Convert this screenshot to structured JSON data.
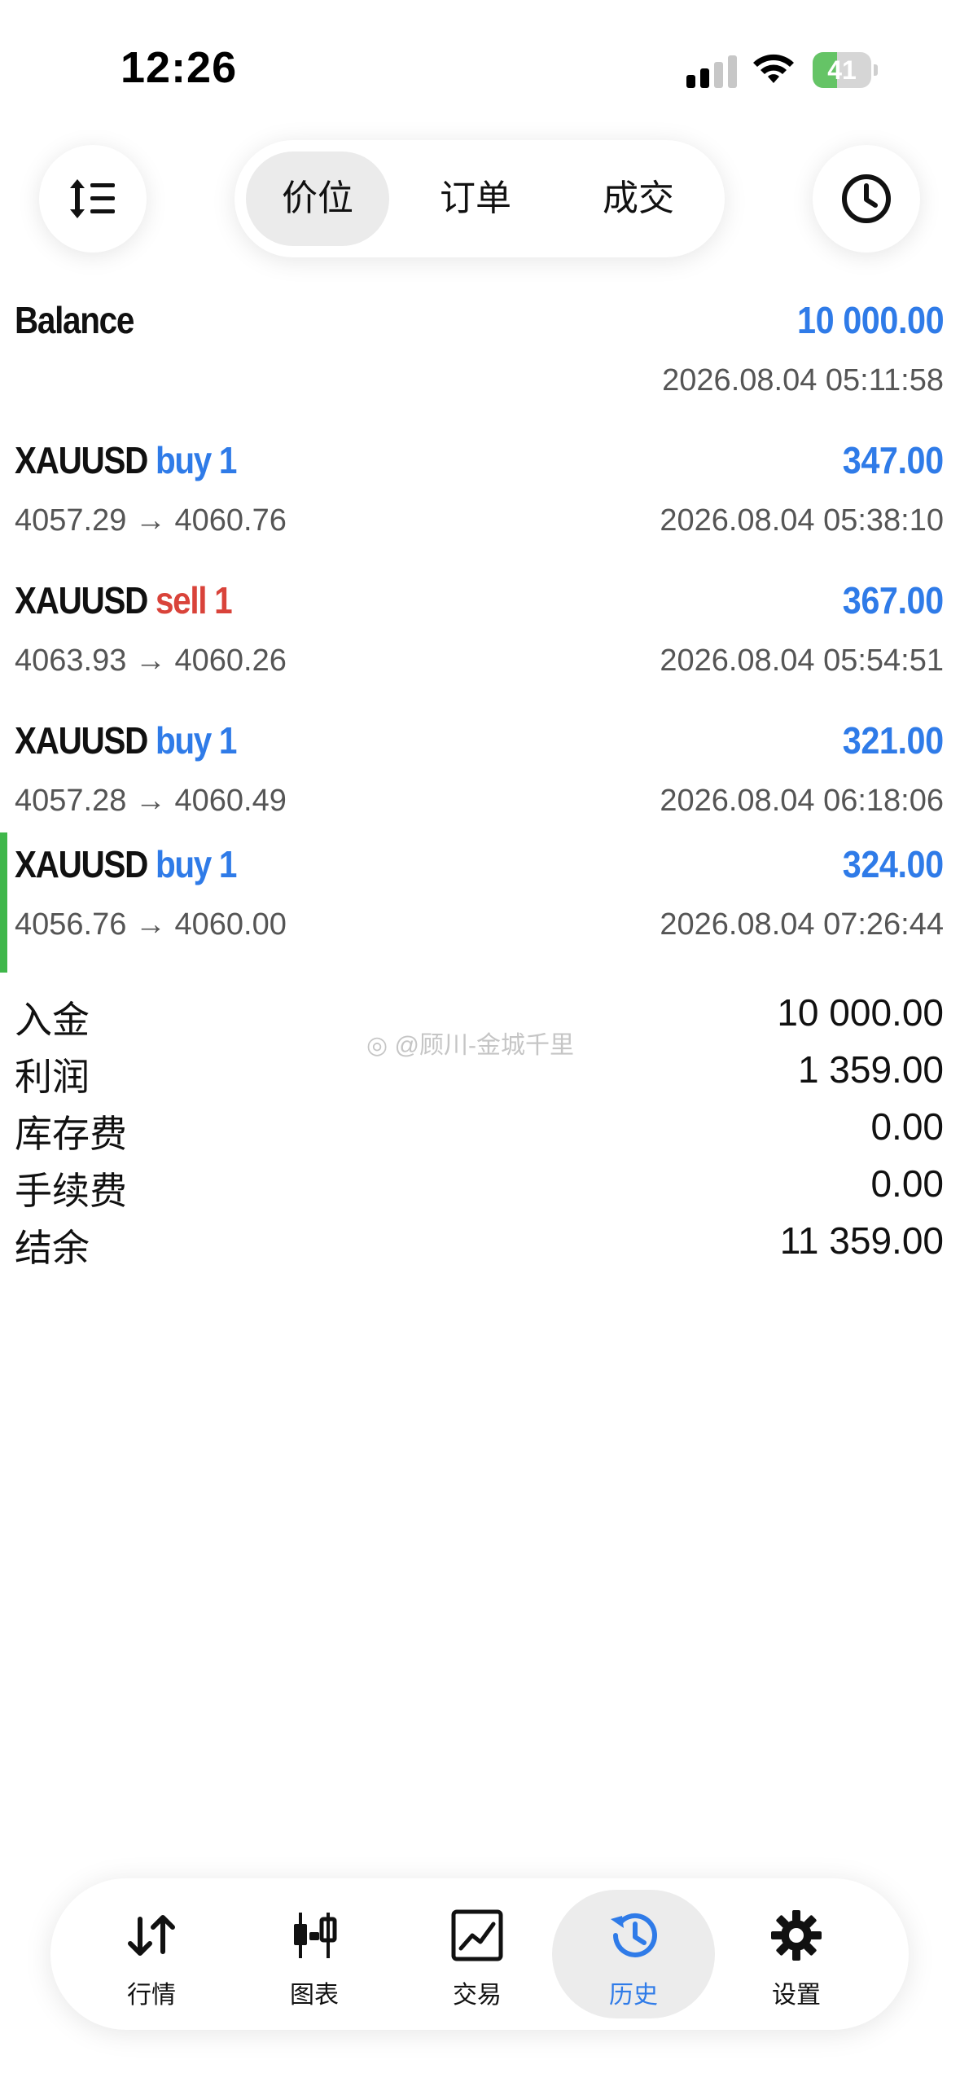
{
  "status": {
    "time": "12:26",
    "battery": "41",
    "battery_level": 0.41
  },
  "toolbar": {
    "segments": [
      {
        "label": "价位",
        "active": true
      },
      {
        "label": "订单",
        "active": false
      },
      {
        "label": "成交",
        "active": false
      }
    ],
    "left_icon": "sort-list-icon",
    "right_icon": "clock-icon"
  },
  "balance": {
    "label": "Balance",
    "amount": "10 000.00",
    "time": "2026.08.04 05:11:58"
  },
  "deals": [
    {
      "symbol": "XAUUSD",
      "direction": "buy 1",
      "type": "buy",
      "prices": "4057.29 → 4060.76",
      "profit": "347.00",
      "time": "2026.08.04 05:38:10"
    },
    {
      "symbol": "XAUUSD",
      "direction": "sell 1",
      "type": "sell",
      "prices": "4063.93 → 4060.26",
      "profit": "367.00",
      "time": "2026.08.04 05:54:51"
    },
    {
      "symbol": "XAUUSD",
      "direction": "buy 1",
      "type": "buy",
      "prices": "4057.28 → 4060.49",
      "profit": "321.00",
      "time": "2026.08.04 06:18:06"
    },
    {
      "symbol": "XAUUSD",
      "direction": "buy 1",
      "type": "buy",
      "prices": "4056.76 → 4060.00",
      "profit": "324.00",
      "time": "2026.08.04 07:26:44"
    }
  ],
  "summary": [
    {
      "label": "入金",
      "value": "10 000.00"
    },
    {
      "label": "利润",
      "value": "1 359.00"
    },
    {
      "label": "库存费",
      "value": "0.00"
    },
    {
      "label": "手续费",
      "value": "0.00"
    },
    {
      "label": "结余",
      "value": "11 359.00"
    }
  ],
  "watermark": "@顾川-金城千里",
  "tabs": [
    {
      "label": "行情",
      "icon": "arrows-up-down-icon",
      "active": false
    },
    {
      "label": "图表",
      "icon": "candlestick-icon",
      "active": false
    },
    {
      "label": "交易",
      "icon": "trade-chart-icon",
      "active": false
    },
    {
      "label": "历史",
      "icon": "history-icon",
      "active": true
    },
    {
      "label": "设置",
      "icon": "gear-icon",
      "active": false
    }
  ],
  "colors": {
    "accent": "#2f7be8",
    "sell": "#d9433a",
    "selected_marker": "#3fb74a",
    "battery": "#65c466"
  }
}
